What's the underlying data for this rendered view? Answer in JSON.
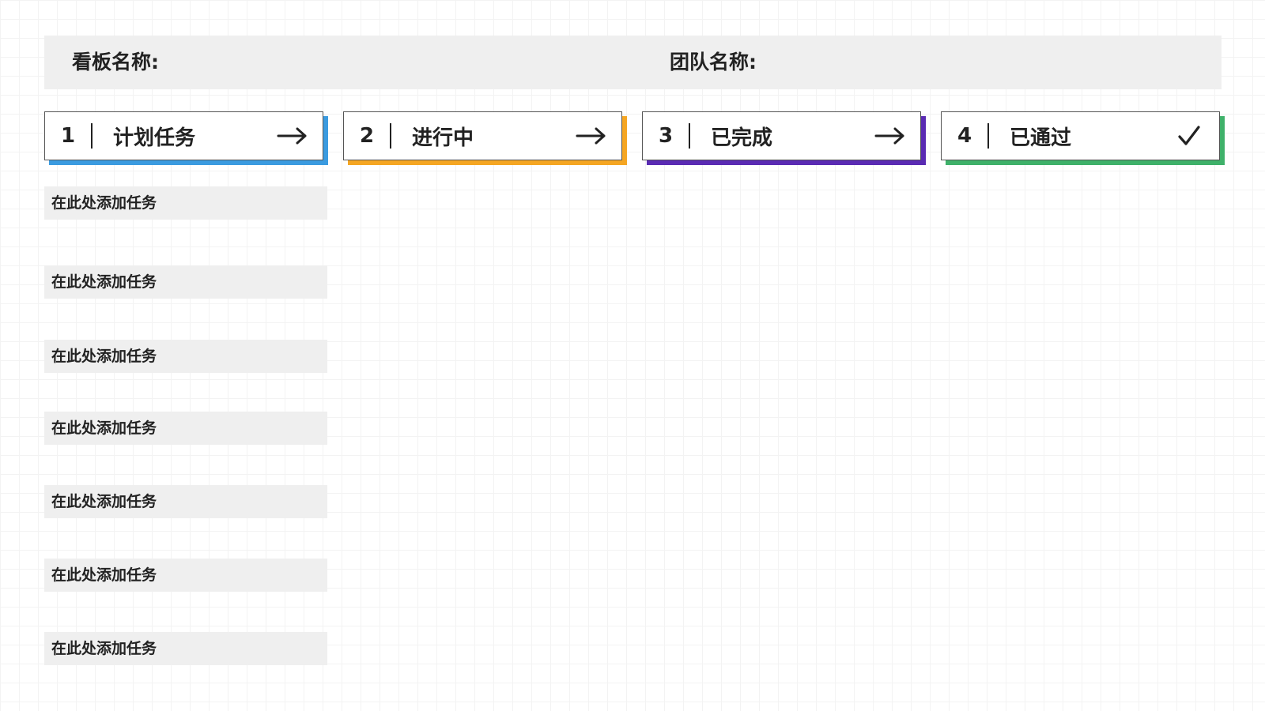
{
  "header": {
    "board_name_label": "看板名称:",
    "team_name_label": "团队名称:"
  },
  "columns": [
    {
      "number": "1",
      "label": "计划任务",
      "icon": "arrow-right-icon",
      "accent": "#3b9be0"
    },
    {
      "number": "2",
      "label": "进行中",
      "icon": "arrow-right-icon",
      "accent": "#f5a623"
    },
    {
      "number": "3",
      "label": "已完成",
      "icon": "arrow-right-icon",
      "accent": "#5a2bb3"
    },
    {
      "number": "4",
      "label": "已通过",
      "icon": "checkmark-icon",
      "accent": "#3fb16a"
    }
  ],
  "tasks": [
    {
      "label": "在此处添加任务"
    },
    {
      "label": "在此处添加任务"
    },
    {
      "label": "在此处添加任务"
    },
    {
      "label": "在此处添加任务"
    },
    {
      "label": "在此处添加任务"
    },
    {
      "label": "在此处添加任务"
    },
    {
      "label": "在此处添加任务"
    }
  ]
}
